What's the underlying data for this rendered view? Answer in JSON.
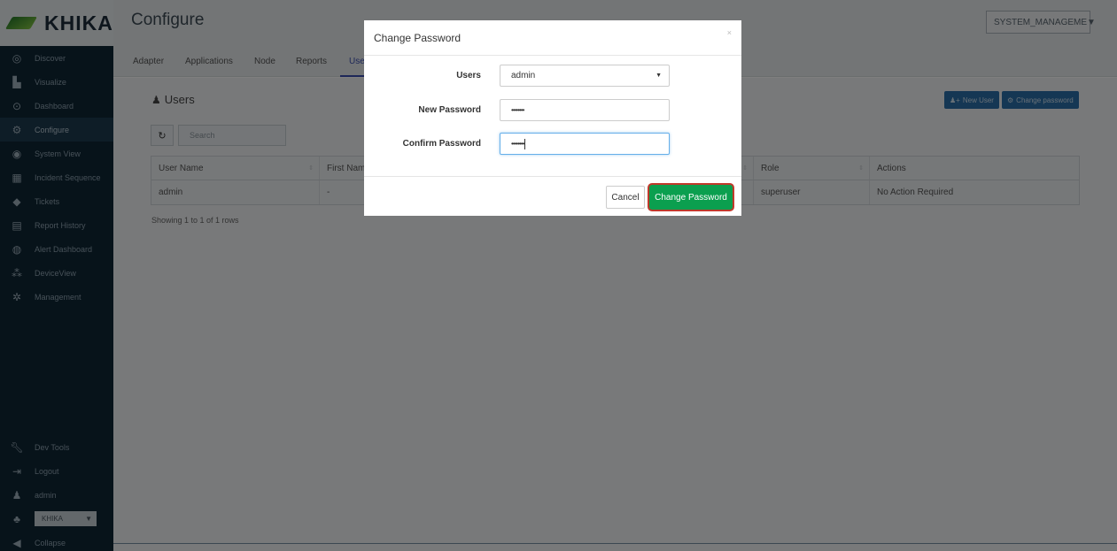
{
  "app": {
    "logo": "KHIKA",
    "page_title": "Configure",
    "system_select": "SYSTEM_MANAGEME"
  },
  "sidebar": {
    "items": [
      {
        "label": "Discover",
        "icon": "compass-icon"
      },
      {
        "label": "Visualize",
        "icon": "bar-chart-icon"
      },
      {
        "label": "Dashboard",
        "icon": "dashboard-icon"
      },
      {
        "label": "Configure",
        "icon": "cogs-icon"
      },
      {
        "label": "System View",
        "icon": "eye-icon"
      },
      {
        "label": "Incident Sequence",
        "icon": "sequence-icon"
      },
      {
        "label": "Tickets",
        "icon": "tag-icon"
      },
      {
        "label": "Report History",
        "icon": "list-icon"
      },
      {
        "label": "Alert Dashboard",
        "icon": "gauge-icon"
      },
      {
        "label": "DeviceView",
        "icon": "sitemap-icon"
      },
      {
        "label": "Management",
        "icon": "gear-icon"
      }
    ],
    "bottom": [
      {
        "label": "Dev Tools",
        "icon": "wrench-icon"
      },
      {
        "label": "Logout",
        "icon": "logout-icon"
      },
      {
        "label": "admin",
        "icon": "user-icon"
      },
      {
        "label": "KHIKA",
        "icon": "users-icon"
      },
      {
        "label": "Collapse",
        "icon": "collapse-icon"
      }
    ]
  },
  "tabs": [
    "Adapter",
    "Applications",
    "Node",
    "Reports",
    "Use"
  ],
  "users_section": {
    "heading": "Users",
    "new_user": "New User",
    "change_password": "Change password",
    "search_placeholder": "Search",
    "columns": [
      "User Name",
      "First Name",
      "Role",
      "Actions"
    ],
    "rows": [
      {
        "user_name": "admin",
        "first_name": "-",
        "role": "superuser",
        "actions": "No Action Required"
      }
    ],
    "showing": "Showing 1 to 1 of 1 rows"
  },
  "modal": {
    "title": "Change Password",
    "close": "×",
    "users_label": "Users",
    "users_value": "admin",
    "new_password_label": "New Password",
    "new_password_value": "••••••••",
    "confirm_password_label": "Confirm Password",
    "confirm_password_value": "••••••••",
    "cancel": "Cancel",
    "submit": "Change Password"
  },
  "colors": {
    "sidebar_bg": "#0e2635",
    "accent_blue": "#2a6ea8",
    "submit_green": "#0b9f4f",
    "highlight_red": "#c0392b"
  }
}
